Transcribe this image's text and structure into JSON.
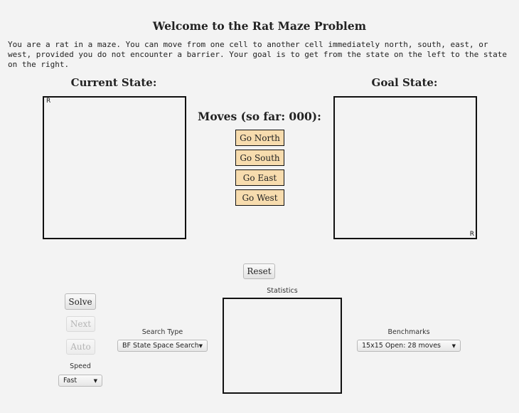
{
  "title": "Welcome to the Rat Maze Problem",
  "description": "You are a rat in a maze. You can move from one cell to another cell immediately north, south, east, or west, provided you do not encounter a barrier. Your goal is to get from the state on the left to the state on the right.",
  "current_state": {
    "heading": "Current State:",
    "rat": "R"
  },
  "goal_state": {
    "heading": "Goal State:",
    "rat": "R"
  },
  "moves": {
    "heading": "Moves (so far: 000):",
    "buttons": [
      "Go North",
      "Go South",
      "Go East",
      "Go West"
    ]
  },
  "reset_label": "Reset",
  "controls": {
    "solve_label": "Solve",
    "next_label": "Next",
    "auto_label": "Auto",
    "speed_label": "Speed",
    "speed_value": "Fast"
  },
  "search": {
    "label": "Search Type",
    "value": "BF State Space Search"
  },
  "statistics_label": "Statistics",
  "benchmarks": {
    "label": "Benchmarks",
    "value": "15x15 Open: 28 moves"
  },
  "icons": {
    "dropdown_arrow": "chevron-down-icon"
  }
}
